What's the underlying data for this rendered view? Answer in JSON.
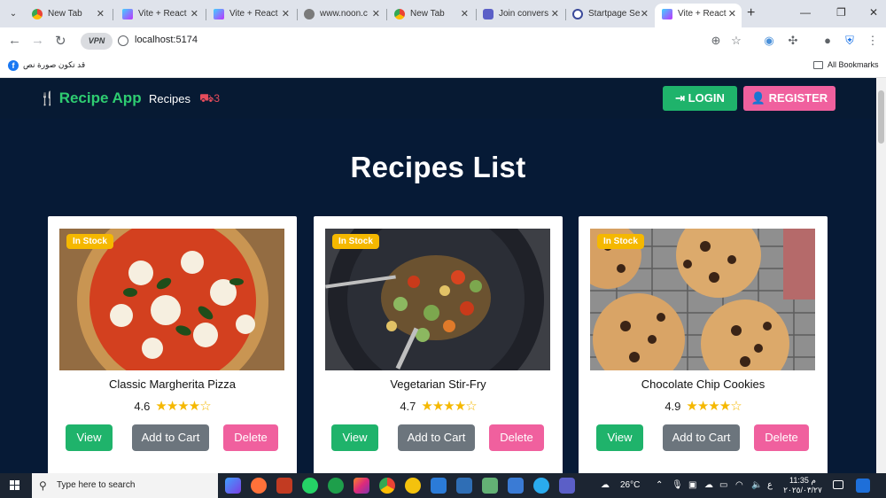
{
  "browser": {
    "tabs": [
      {
        "title": "New Tab",
        "active": false,
        "icon": "chrome-icon"
      },
      {
        "title": "Vite + React",
        "active": false,
        "icon": "vite-icon"
      },
      {
        "title": "Vite + React",
        "active": false,
        "icon": "vite-icon"
      },
      {
        "title": "www.noon.c",
        "active": false,
        "icon": "globe-icon"
      },
      {
        "title": "New Tab",
        "active": false,
        "icon": "chrome-icon"
      },
      {
        "title": "Join convers",
        "active": false,
        "icon": "teams-icon"
      },
      {
        "title": "Startpage Se",
        "active": false,
        "icon": "startpage-icon"
      },
      {
        "title": "Vite + React",
        "active": true,
        "icon": "vite-icon"
      }
    ],
    "new_tab": "+",
    "vpn_label": "VPN",
    "url": "localhost:5174",
    "bookmark_label": "قد تكون صورة نص",
    "all_bookmarks": "All Bookmarks"
  },
  "app": {
    "brand": "Recipe App",
    "nav_recipes": "Recipes",
    "cart_count": "3",
    "login_label": "LOGIN",
    "register_label": "REGISTER",
    "page_title": "Recipes List",
    "recipes": [
      {
        "title": "Classic Margherita Pizza",
        "rating": "4.6",
        "stars": 4,
        "badge": "In Stock"
      },
      {
        "title": "Vegetarian Stir-Fry",
        "rating": "4.7",
        "stars": 4,
        "badge": "In Stock"
      },
      {
        "title": "Chocolate Chip Cookies",
        "rating": "4.9",
        "stars": 4,
        "badge": "In Stock"
      }
    ],
    "buttons": {
      "view": "View",
      "add_to_cart": "Add to Cart",
      "delete": "Delete"
    }
  },
  "taskbar": {
    "search_placeholder": "Type here to search",
    "weather": "26°C",
    "time": "11:35 م",
    "date": "٢٠٢٥/٠٣/٢٧",
    "lang": "ع"
  },
  "colors": {
    "nav_bg": "#071a33",
    "brand_green": "#2ecc71",
    "login_green": "#1fb36b",
    "register_pink": "#f0609e",
    "badge_yellow": "#f5b800",
    "cart_red": "#e74c5c"
  }
}
